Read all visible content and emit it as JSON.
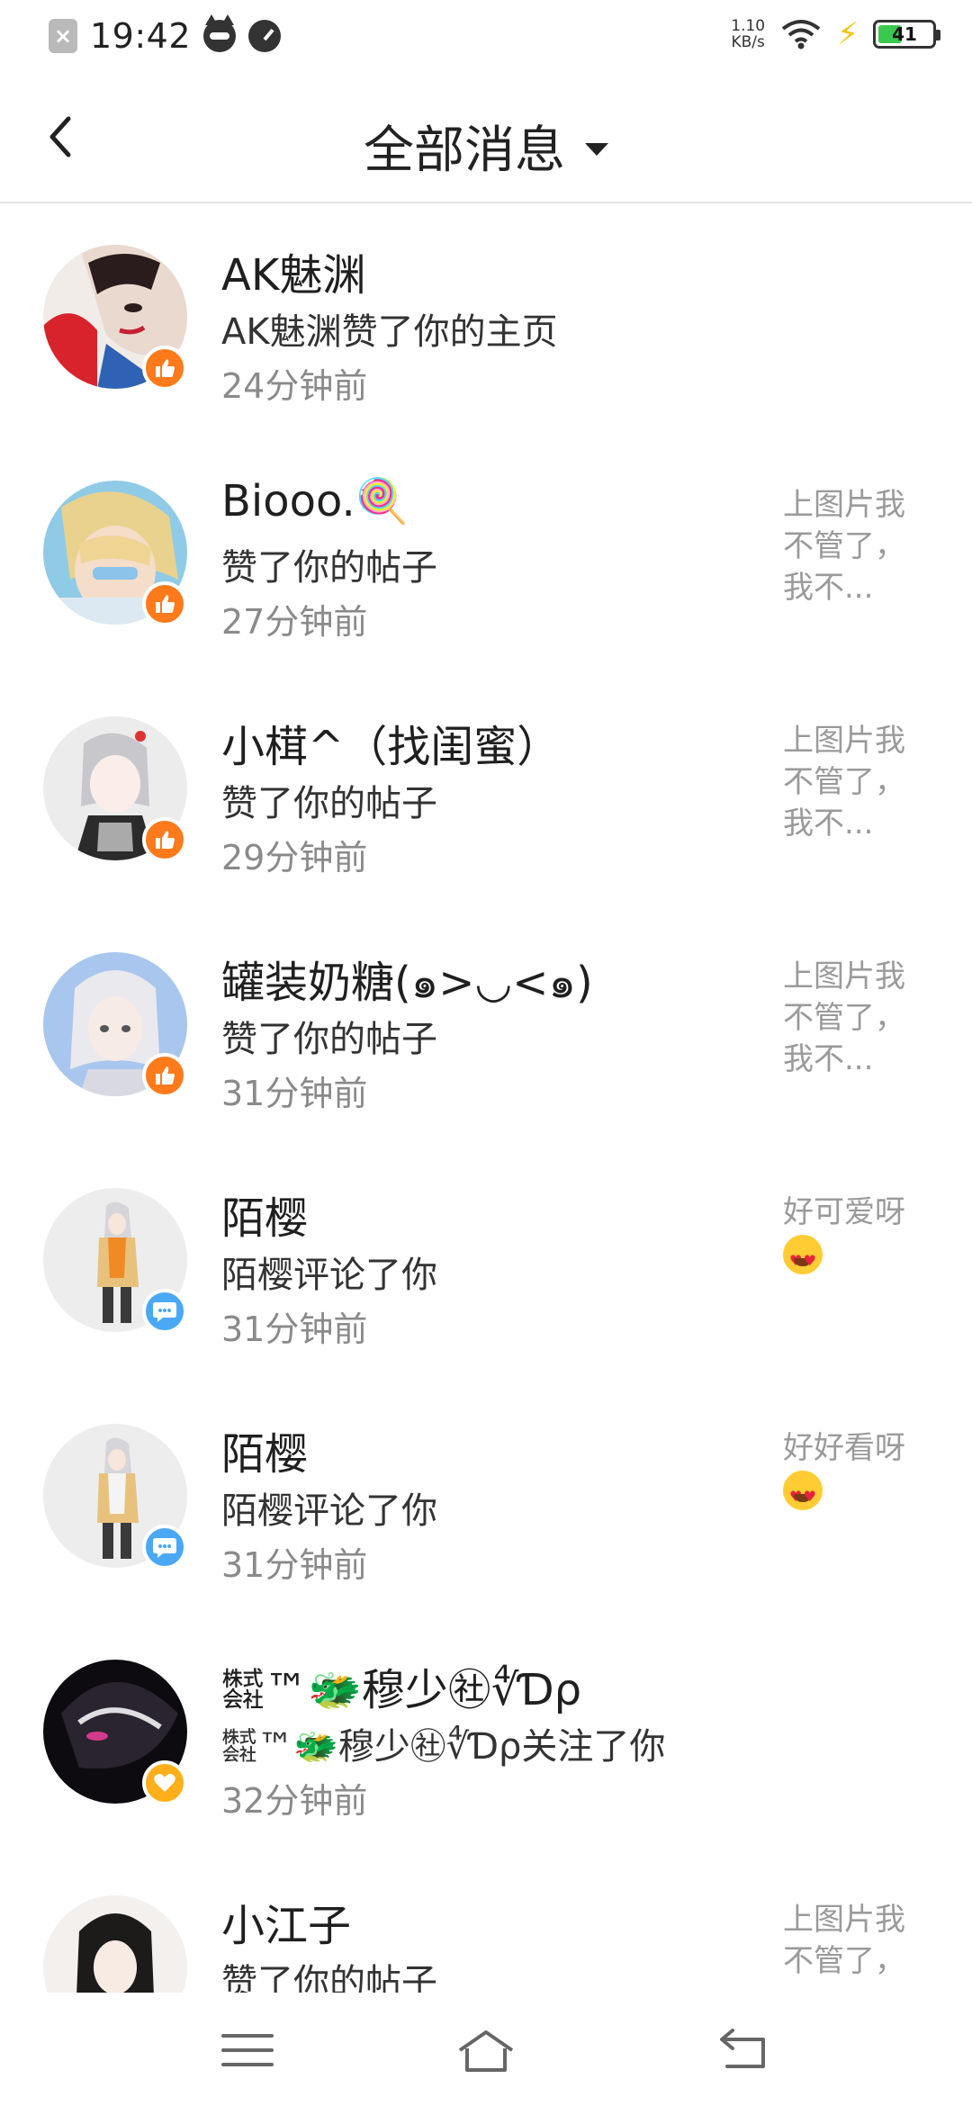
{
  "status_bar": {
    "time": "19:42",
    "net_speed": "1.10",
    "net_unit": "KB/s",
    "battery": "41",
    "battery_level": 0.41,
    "battery_color": "#3bc84f"
  },
  "header": {
    "title": "全部消息",
    "back_icon": "chevron-left-icon",
    "dropdown_icon": "caret-down-icon"
  },
  "colors": {
    "like_badge": "#ff7a1a",
    "comment_badge": "#4aa8f5",
    "follow_badge": "#ffaf1a"
  },
  "messages": [
    {
      "name": "AK魅渊",
      "action": "AK魅渊赞了你的主页",
      "time": "24分钟前",
      "preview": "",
      "badge": "like"
    },
    {
      "name": "Biooo.🍭",
      "action": "赞了你的帖子",
      "time": "27分钟前",
      "preview": "上图片我不管了，我不...",
      "badge": "like"
    },
    {
      "name": "小榵^（找闺蜜）",
      "action": "赞了你的帖子",
      "time": "29分钟前",
      "preview": "上图片我不管了，我不...",
      "badge": "like"
    },
    {
      "name": "罐装奶糖(๑>◡<๑)",
      "action": "赞了你的帖子",
      "time": "31分钟前",
      "preview": "上图片我不管了，我不...",
      "badge": "like"
    },
    {
      "name": "陌樱",
      "action": "陌樱评论了你",
      "time": "31分钟前",
      "preview": "好可爱呀",
      "badge": "comment"
    },
    {
      "name": "陌樱",
      "action": "陌樱评论了你",
      "time": "31分钟前",
      "preview": "好好看呀",
      "badge": "comment"
    },
    {
      "name": "㍿™🐲穆少㊓∜Ɗρ",
      "action": "㍿™🐲穆少㊓∜Ɗρ关注了你",
      "time": "32分钟前",
      "preview": "",
      "badge": "follow"
    },
    {
      "name": "小江子",
      "action": "赞了你的帖子",
      "time": "",
      "preview": "上图片我不管了，",
      "badge": "like"
    }
  ],
  "nav_bar": {
    "menu_icon": "menu-icon",
    "home_icon": "home-icon",
    "back_icon": "back-icon"
  }
}
